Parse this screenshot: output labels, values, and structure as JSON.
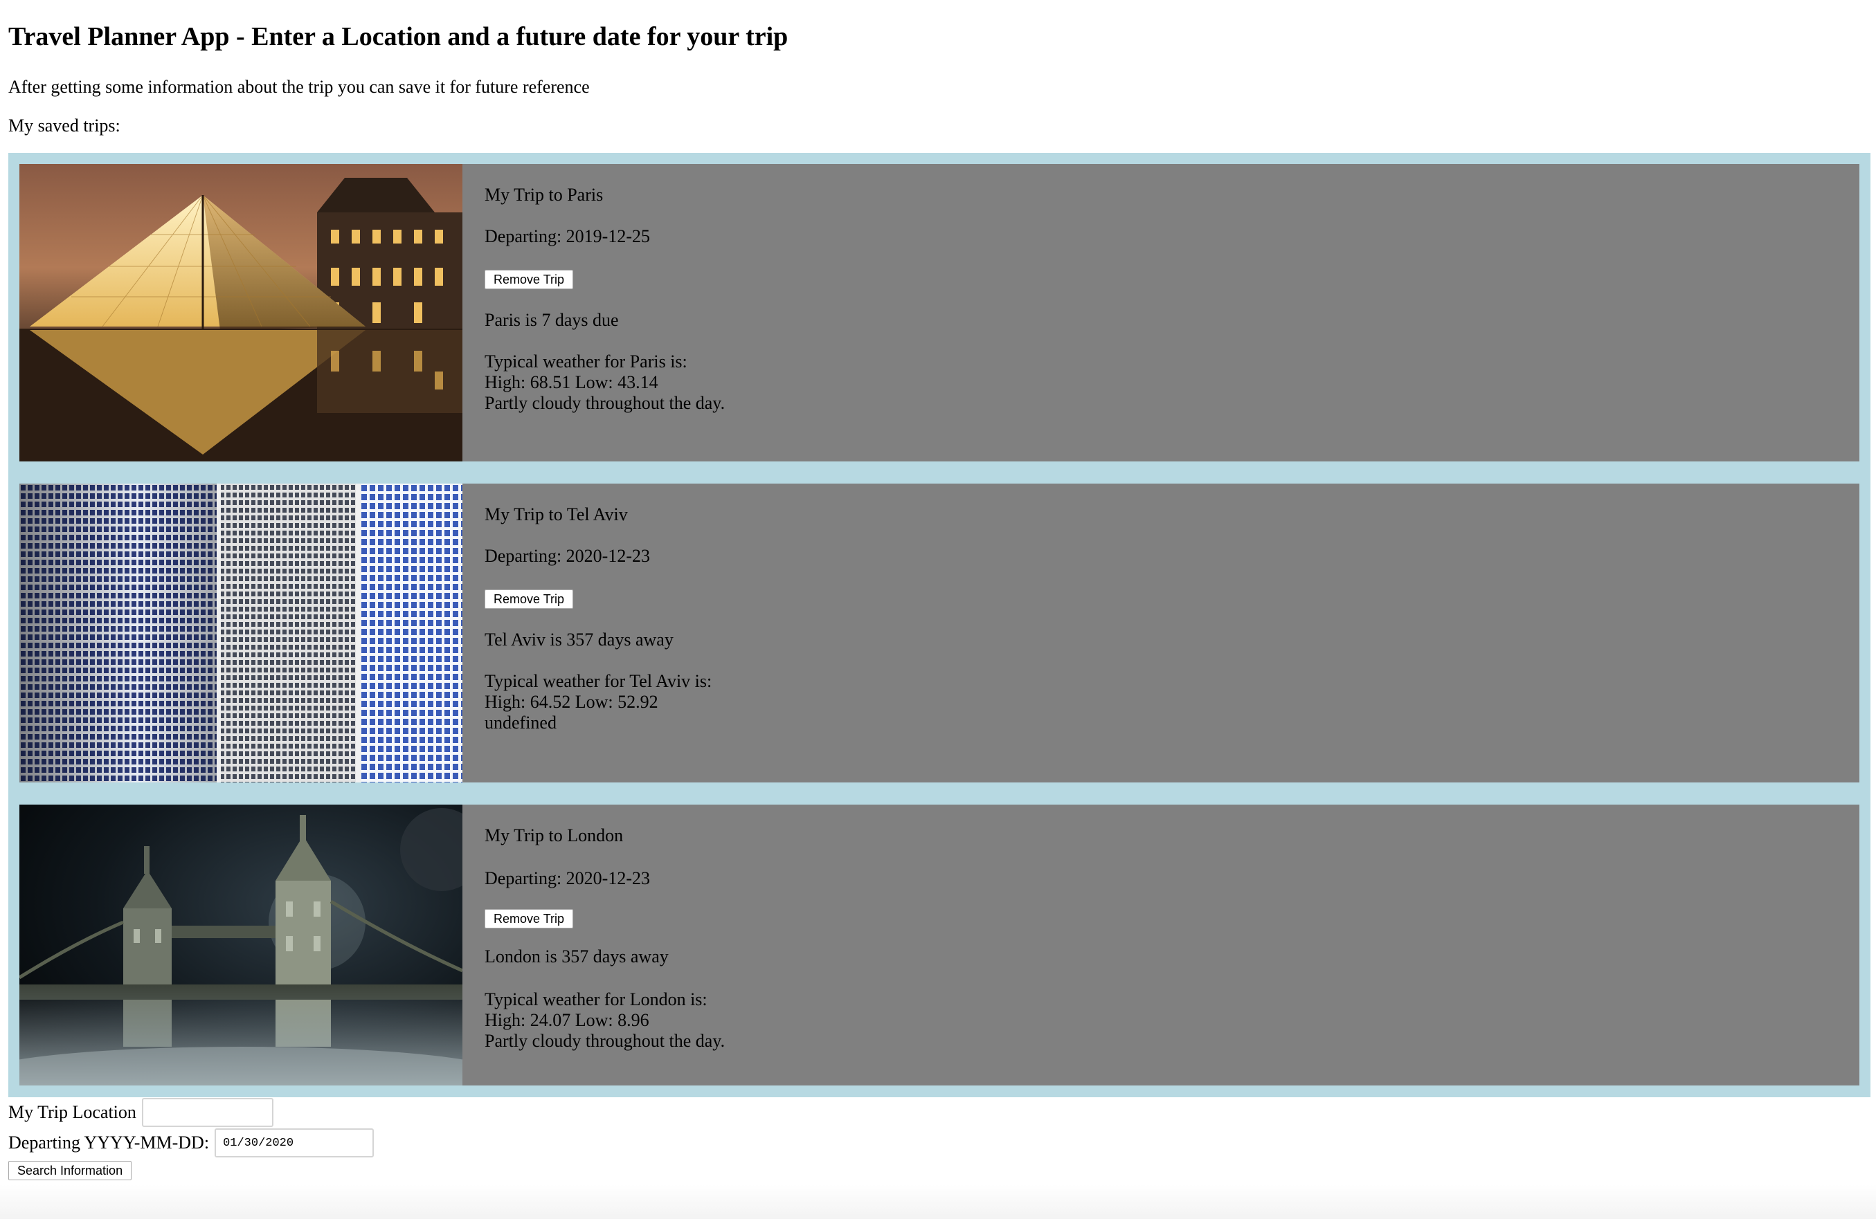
{
  "header": {
    "title": "Travel Planner App - Enter a Location and a future date for your trip",
    "intro": "After getting some information about the trip you can save it for future reference",
    "saved_label": "My saved trips:"
  },
  "trips": [
    {
      "title": "My Trip to Paris",
      "departing": "Departing: 2019-12-25",
      "remove_label": "Remove Trip",
      "countdown": "Paris is 7 days due",
      "weather_heading": "Typical weather for Paris is:",
      "weather_temps": "High: 68.51 Low: 43.14",
      "weather_summary": "Partly cloudy throughout the day.",
      "image_subject": "louvre-pyramid-at-night"
    },
    {
      "title": "My Trip to Tel Aviv",
      "departing": "Departing: 2020-12-23",
      "remove_label": "Remove Trip",
      "countdown": "Tel Aviv is 357 days away",
      "weather_heading": "Typical weather for Tel Aviv is:",
      "weather_temps": "High: 64.52 Low: 52.92",
      "weather_summary": "undefined",
      "image_subject": "azrieli-towers-facade"
    },
    {
      "title": "My Trip to London",
      "departing": "Departing: 2020-12-23",
      "remove_label": "Remove Trip",
      "countdown": "London is 357 days away",
      "weather_heading": "Typical weather for London is:",
      "weather_temps": "High: 24.07 Low: 8.96",
      "weather_summary": "Partly cloudy throughout the day.",
      "image_subject": "tower-bridge-at-night"
    }
  ],
  "form": {
    "location_label": "My Trip Location",
    "location_value": "",
    "date_label": "Departing YYYY-MM-DD:",
    "date_value": "01/30/2020",
    "search_label": "Search Information"
  },
  "colors": {
    "trips_background": "#b7d9e2",
    "trip_card_background": "#808080"
  }
}
